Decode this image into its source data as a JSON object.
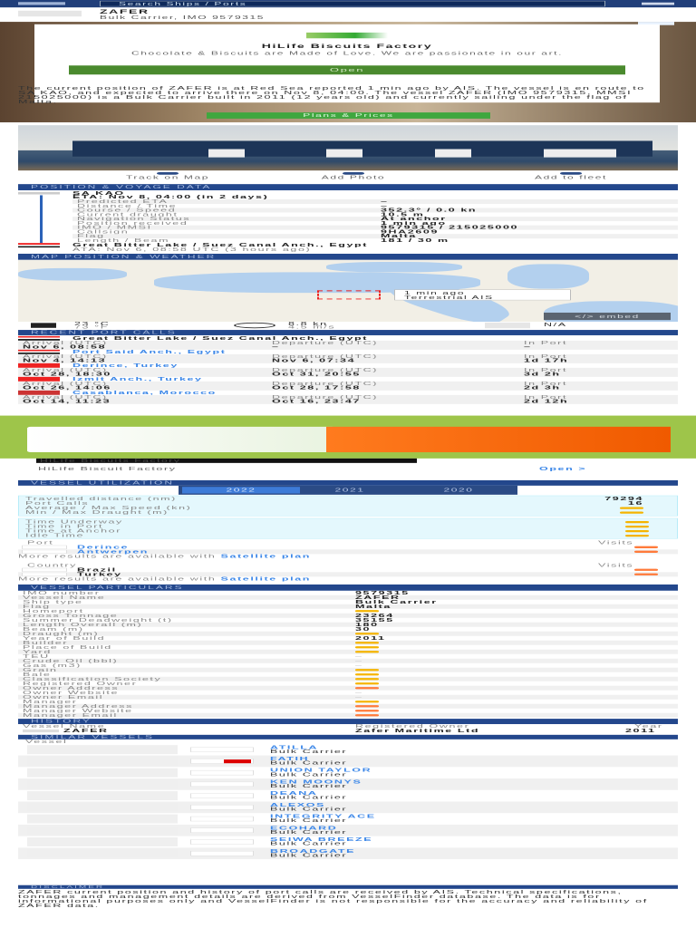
{
  "header": {
    "search_placeholder": "Search Ships / Ports"
  },
  "vessel": {
    "name": "ZAFER",
    "subtitle": "Bulk Carrier, IMO 9579315"
  },
  "ad_top": {
    "title": "HiLife Biscuits Factory",
    "text": "Chocolate & Biscuits are Made of Love. We are passionate in our art.",
    "button": "Open"
  },
  "description": "The current position of ZAFER is at Red Sea reported 1 min ago by AIS. The vessel is en route to SA KAO, and expected to arrive there on Nov 8, 04:00. The vessel ZAFER (IMO 9579315, MMSI 215025000) is a Bulk Carrier built in 2011 (12 years old) and currently sailing under the flag of Malta.",
  "plans_button": "Plans & Prices",
  "actions": [
    "Track on Map",
    "Add Photo",
    "Add to fleet"
  ],
  "sections": {
    "voyage": "POSITION & VOYAGE DATA",
    "map": "MAP POSITION & WEATHER",
    "calls": "RECENT PORT CALLS",
    "util": "VESSEL UTILIZATION",
    "particulars": "VESSEL PARTICULARS",
    "history": "HISTORY",
    "similar": "SIMILAR VESSELS",
    "disclaimer": "DISCLAIMER"
  },
  "voyage": {
    "destination": "SA KAO",
    "eta": "ETA: Nov 8, 04:00 (in 2 days)",
    "rows": [
      [
        "Predicted ETA",
        "–"
      ],
      [
        "Distance / Time",
        "–"
      ],
      [
        "Course / Speed",
        "352.3° / 0.0 kn"
      ],
      [
        "Current draught",
        "10.5 m"
      ],
      [
        "Navigation Status",
        "At anchor"
      ],
      [
        "Position received",
        "1 min ago"
      ],
      [
        "IMO / MMSI",
        "9579315 / 215025000"
      ],
      [
        "Callsign",
        "9HA2609"
      ],
      [
        "Flag",
        "Malta"
      ],
      [
        "Length / Beam",
        "181 / 30 m"
      ]
    ],
    "last_port": "Great Bitter Lake / Suez Canal Anch., Egypt",
    "ata": "ATA: Nov 6, 08:58 UTC (3 hours ago)"
  },
  "map": {
    "popup_time": "1 min ago",
    "popup_source": "Terrestrial AIS",
    "embed": "</> embed"
  },
  "weather": {
    "temp_c": "23 °C",
    "temp_f": "73 °F",
    "wind_kn": "8.8 kn",
    "wind_ms": "4.5 m/s",
    "waves": "N/A"
  },
  "port_calls": {
    "labels": [
      "Arrival (UTC)",
      "Departure (UTC)",
      "In Port"
    ],
    "items": [
      {
        "port": "Great Bitter Lake / Suez Canal Anch., Egypt",
        "flag": "EG",
        "arrival": "Nov 6, 08:58",
        "departure": "–",
        "in_port": "–"
      },
      {
        "port": "Port Said Anch., Egypt",
        "flag": "EG",
        "arrival": "Nov 4, 14:13",
        "departure": "Nov 6, 07:34",
        "in_port": "1d 17h"
      },
      {
        "port": "Derince, Turkey",
        "flag": "TR",
        "arrival": "Oct 28, 18:30",
        "departure": "Oct 31, 20:55",
        "in_port": "3d 2h"
      },
      {
        "port": "Izmit Anch., Turkey",
        "flag": "TR",
        "arrival": "Oct 26, 14:06",
        "departure": "Oct 28, 17:58",
        "in_port": "2d 3h"
      },
      {
        "port": "Casablanca, Morocco",
        "flag": "MA",
        "arrival": "Oct 14, 11:23",
        "departure": "Oct 16, 23:47",
        "in_port": "2d 12h"
      }
    ]
  },
  "ad_bottom": {
    "tagline": "HiLife Biscuits Factory",
    "name": "HiLife Biscuit Factory",
    "open": "Open >"
  },
  "utilization": {
    "years": [
      "2022",
      "2021",
      "2020"
    ],
    "stats": [
      [
        "Travelled distance (nm)",
        "79294"
      ],
      [
        "Port Calls",
        "16"
      ],
      [
        "Average / Max Speed (kn)",
        ""
      ],
      [
        "Min / Max Draught (m)",
        ""
      ]
    ],
    "times": [
      "Time Underway",
      "Time in Port",
      "Time at Anchor",
      "Idle Time"
    ],
    "port_header": [
      "Port",
      "Visits"
    ],
    "ports": [
      "Derince",
      "Antwerpen"
    ],
    "more_text": "More results are available with",
    "more_link": "Satellite plan",
    "country_header": [
      "Country",
      "Visits"
    ],
    "countries": [
      "Brazil",
      "Turkey"
    ]
  },
  "particulars": [
    [
      "IMO number",
      "9579315"
    ],
    [
      "Vessel Name",
      "ZAFER"
    ],
    [
      "Ship type",
      "Bulk Carrier"
    ],
    [
      "Flag",
      "Malta"
    ],
    [
      "Homeport",
      ""
    ],
    [
      "Gross Tonnage",
      "23264"
    ],
    [
      "Summer Deadweight (t)",
      "35155"
    ],
    [
      "Length Overall (m)",
      "180"
    ],
    [
      "Beam (m)",
      "30"
    ],
    [
      "Draught (m)",
      ""
    ],
    [
      "Year of Build",
      "2011"
    ],
    [
      "Builder",
      ""
    ],
    [
      "Place of Build",
      ""
    ],
    [
      "Yard",
      ""
    ],
    [
      "TEU",
      "–"
    ],
    [
      "Crude Oil (bbl)",
      "–"
    ],
    [
      "Gas (m3)",
      "–"
    ],
    [
      "Grain",
      ""
    ],
    [
      "Bale",
      ""
    ],
    [
      "Classification Society",
      ""
    ],
    [
      "Registered Owner",
      ""
    ],
    [
      "Owner Address",
      "o"
    ],
    [
      "Owner Website",
      "–"
    ],
    [
      "Owner Email",
      "–"
    ],
    [
      "Manager",
      ""
    ],
    [
      "Manager Address",
      "o"
    ],
    [
      "Manager Website",
      "o"
    ],
    [
      "Manager Email",
      "o"
    ]
  ],
  "history": {
    "headers": [
      "Vessel Name",
      "Registered Owner",
      "Year"
    ],
    "rows": [
      [
        "ZAFER",
        "Zafer Maritime Ltd",
        "2011"
      ]
    ]
  },
  "similar": {
    "header": "Vessel",
    "items": [
      [
        "ATILLA",
        "Bulk Carrier"
      ],
      [
        "FATIH",
        "Bulk Carrier"
      ],
      [
        "UNION TAYLOR",
        "Bulk Carrier"
      ],
      [
        "KEN MOONYS",
        "Bulk Carrier"
      ],
      [
        "DEANA",
        "Bulk Carrier"
      ],
      [
        "ALEXOS",
        "Bulk Carrier"
      ],
      [
        "INTEGRITY ACE",
        "Bulk Carrier"
      ],
      [
        "ECOHARD",
        "Bulk Carrier"
      ],
      [
        "SEIWA BREEZE",
        "Bulk Carrier"
      ],
      [
        "BROADGATE",
        "Bulk Carrier"
      ]
    ]
  },
  "disclaimer": "ZAFER current position and history of port calls are received by AIS. Technical specifications, tonnages and management details are derived from VesselFinder database. The data is for informational purposes only and VesselFinder is not responsible for the accuracy and reliability of ZAFER data.",
  "colors": {
    "navy": "#213f7a",
    "section": "#23478c",
    "link": "#3a86e8",
    "green": "#4a8a2e",
    "dash": "#f5b400",
    "dash_orange": "#ff7a3a"
  }
}
